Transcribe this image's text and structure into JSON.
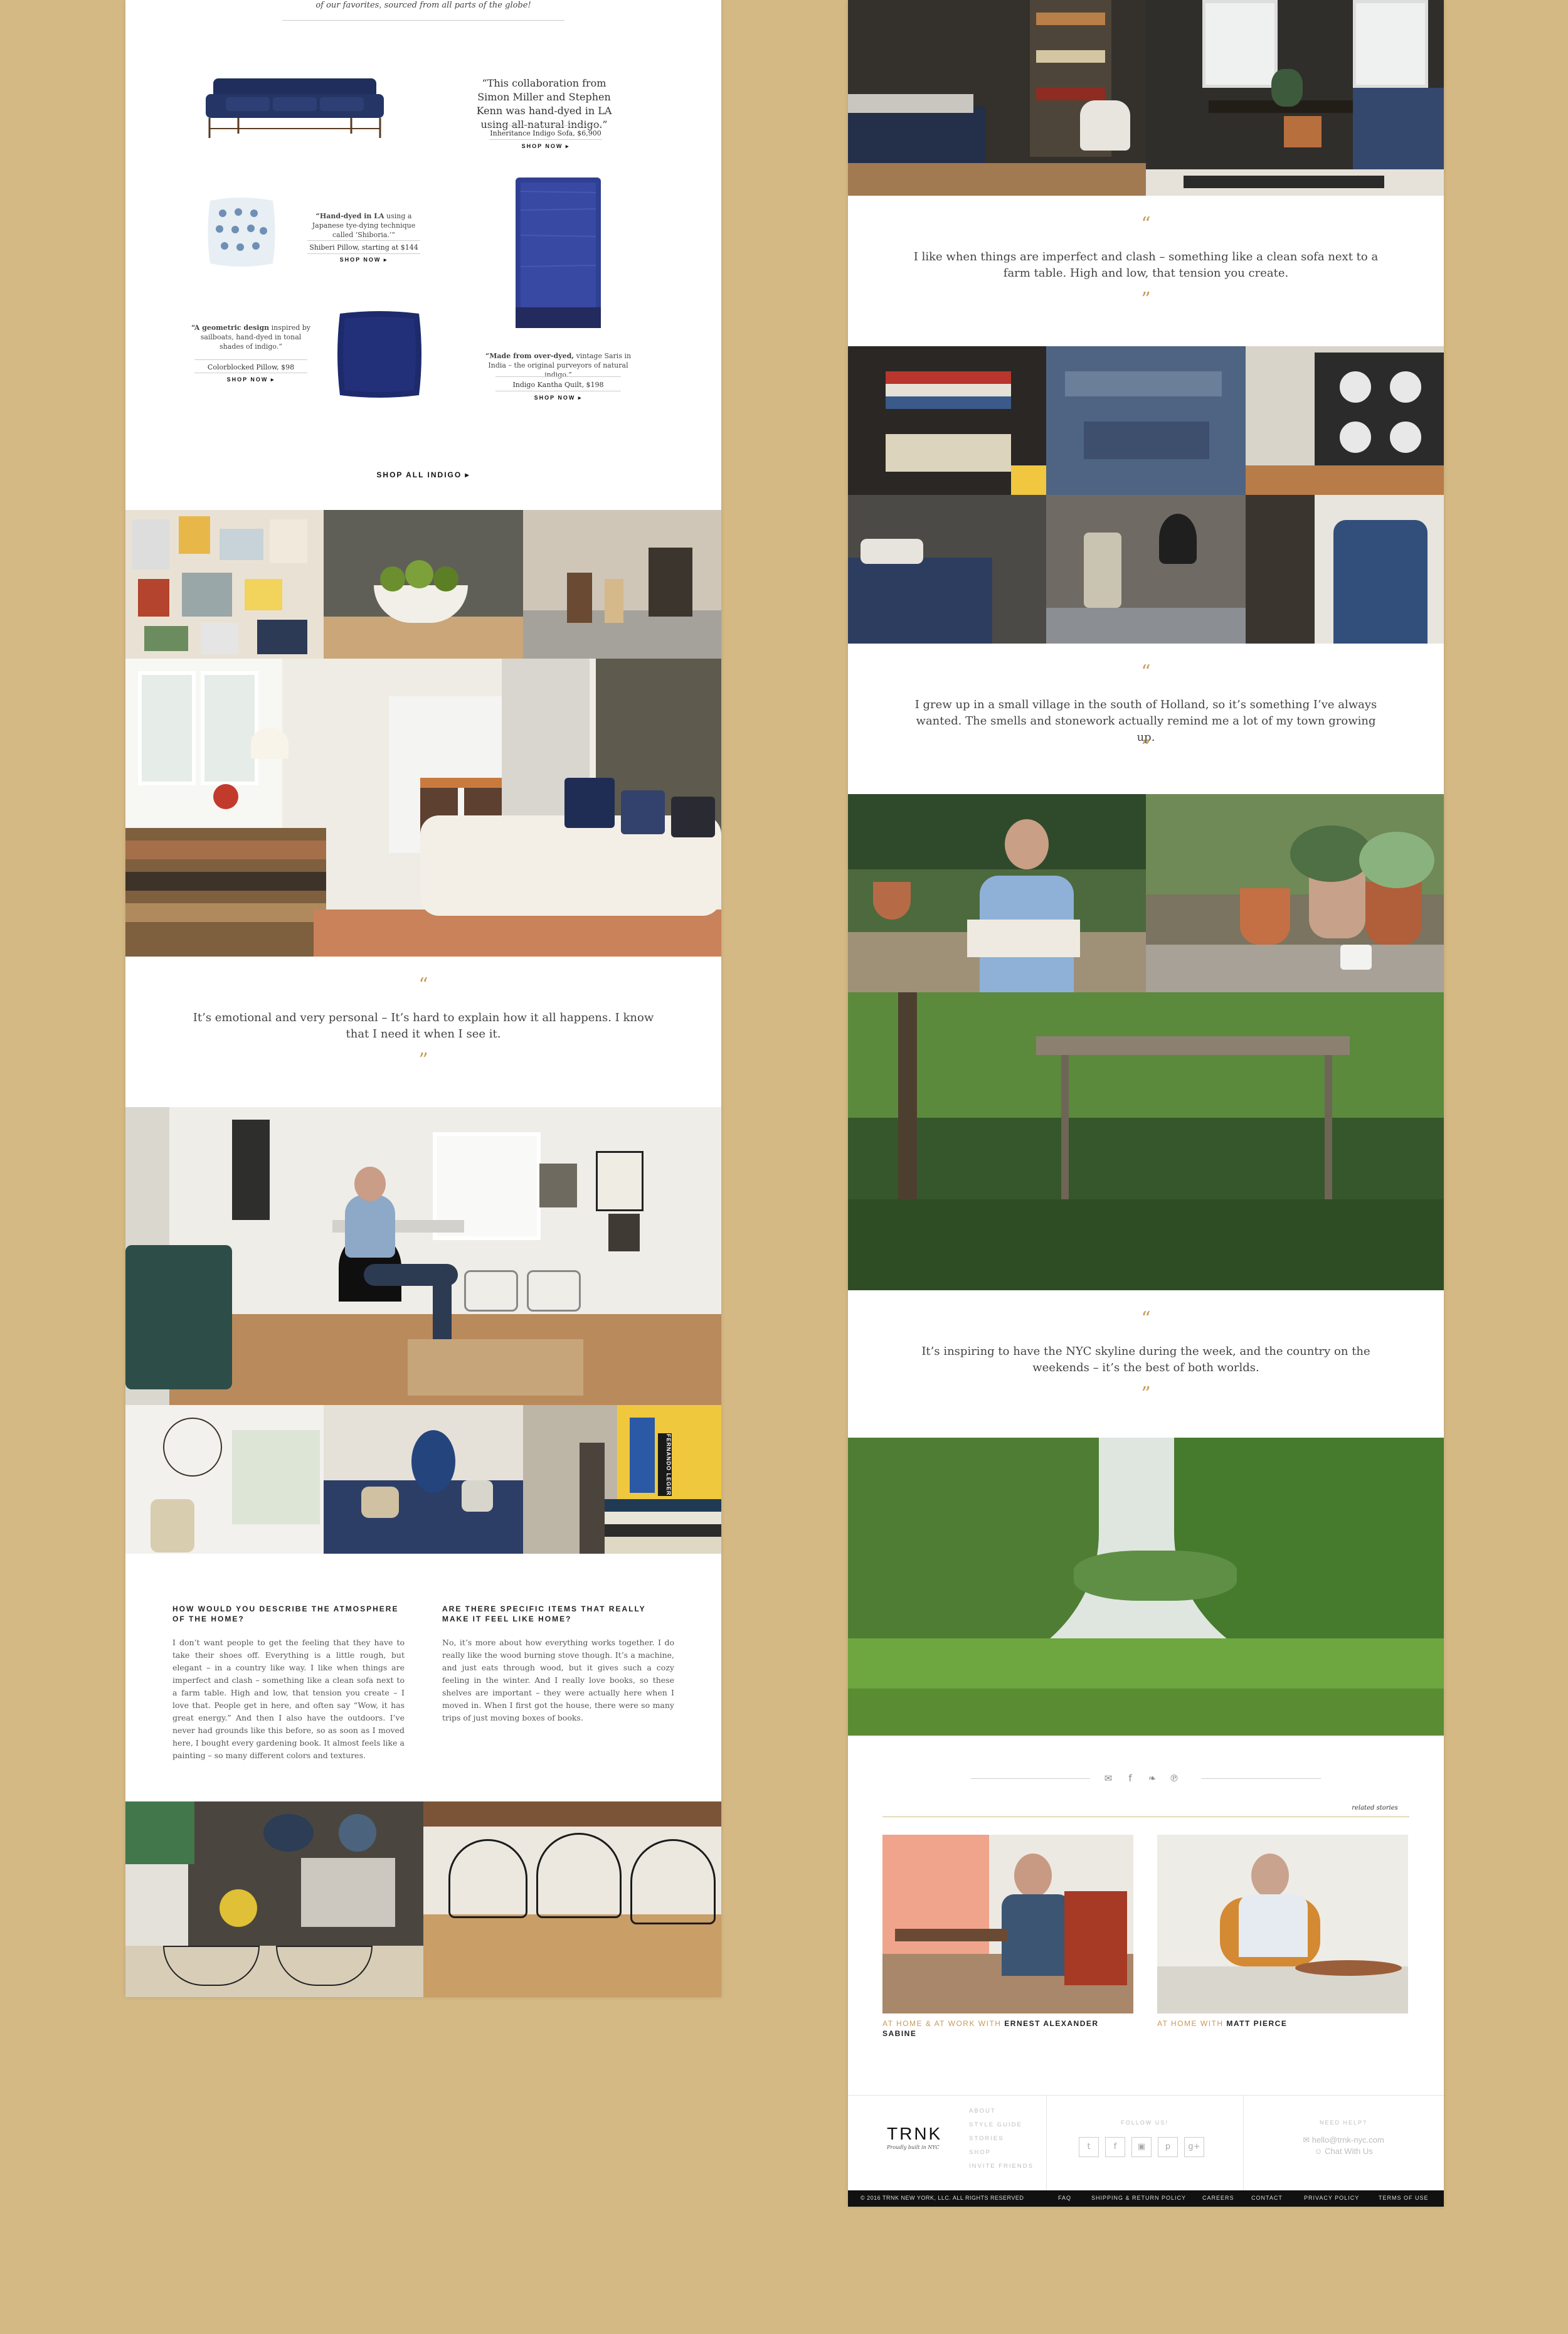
{
  "intro": {
    "line1": "",
    "line2": "of our favorites, sourced from all parts of the globe!"
  },
  "products": [
    {
      "quote": "“This collaboration from Simon Miller and Stephen Kenn was hand-dyed in LA using all-natural indigo.”",
      "name": "Inheritance Indigo Sofa, $6,900",
      "cta": "SHOP NOW ▸"
    },
    {
      "quote_bold": "“Hand-dyed in LA",
      "quote_rest": " using a Japanese tye-dying technique called ‘Shiboria.’”",
      "name": "Shiberi Pillow, starting at $144",
      "cta": "SHOP NOW ▸"
    },
    {
      "quote_bold": "“A geometric design",
      "quote_rest": " inspired by sailboats, hand-dyed in tonal shades of indigo.”",
      "name": "Colorblocked Pillow, $98",
      "cta": "SHOP NOW ▸"
    },
    {
      "quote_bold": "“Made from over-dyed,",
      "quote_rest": " vintage Saris in India – the original purveyors of natural indigo.”",
      "name": "Indigo Kantha Quilt, $198",
      "cta": "SHOP NOW ▸"
    }
  ],
  "shop_all": "SHOP ALL INDIGO ▸",
  "quotes": {
    "open": "“",
    "close": "”",
    "left1": "It’s emotional and very personal – It’s hard to explain how it all happens. I know that I need it when I see it.",
    "right1": "I like when things are imperfect and clash – something like a clean sofa next to a farm table. High and low, that tension you create.",
    "right2": "I grew up in a small village in the south of Holland, so it’s something I’ve always wanted. The smells and stonework actually remind me a lot of my town growing up.",
    "right3": "It’s inspiring to have the NYC skyline during the week, and the country on the weekends – it’s the best of both worlds."
  },
  "interview": [
    {
      "question": "HOW WOULD YOU DESCRIBE THE ATMOSPHERE OF THE HOME?",
      "answer": "I don’t want people to get the feeling that they have to take their shoes off. Everything is a little rough, but elegant – in a country like way. I like when things are imperfect and clash – something like a clean sofa next to a farm table. High and low, that tension you create – I love that. People get in here, and often say “Wow, it has great energy.” And then I also have the outdoors. I’ve never had grounds like this before, so as soon as I moved here, I bought every gardening book. It almost feels like a painting – so many different colors and textures."
    },
    {
      "question": "ARE THERE SPECIFIC ITEMS THAT REALLY MAKE IT FEEL LIKE HOME?",
      "answer": "No, it’s more about how everything works together. I do really like the wood burning stove though. It’s a machine, and just eats through wood, but it gives such a cozy feeling in the winter. And I really love books, so these shelves are important – they were actually here when I moved in. When I first got the house, there were so many trips of just moving boxes of books."
    }
  ],
  "book_spine": "FERNANDO LEGER",
  "share_icons": [
    "mail-icon",
    "facebook-icon",
    "twitter-icon",
    "pinterest-icon"
  ],
  "share_glyphs": {
    "mail": "✉",
    "facebook": "f",
    "twitter": "❧",
    "pinterest": "℗"
  },
  "related": {
    "label": "related stories",
    "items": [
      {
        "prefix": "AT HOME & AT WORK WITH ",
        "name": "ERNEST ALEXANDER SABINE"
      },
      {
        "prefix": "AT HOME WITH ",
        "name": "MATT PIERCE"
      }
    ]
  },
  "footer": {
    "logo": "TRNK",
    "tagline": "Proudly built in NYC",
    "nav": [
      "ABOUT",
      "STYLE GUIDE",
      "STORIES",
      "SHOP",
      "INVITE FRIENDS"
    ],
    "follow_title": "FOLLOW US!",
    "social": [
      "twitter-icon",
      "facebook-icon",
      "instagram-icon",
      "pinterest-icon",
      "googleplus-icon"
    ],
    "social_glyphs": {
      "twitter": "t",
      "facebook": "f",
      "instagram": "▣",
      "pinterest": "p",
      "googleplus": "g+"
    },
    "help_title": "NEED HELP?",
    "email": "✉ hello@trnk-nyc.com",
    "chat": "☺ Chat With Us"
  },
  "bottom_bar": {
    "copyright": "© 2016 TRNK New York, LLC. All Rights Reserved",
    "links": [
      "FAQ",
      "SHIPPING & RETURN POLICY",
      "CAREERS",
      "CONTACT",
      "PRIVACY POLICY",
      "TERMS OF USE"
    ]
  },
  "colors": {
    "background": "#d4b985",
    "accent": "#c79a55",
    "footer_bar": "#111111"
  }
}
